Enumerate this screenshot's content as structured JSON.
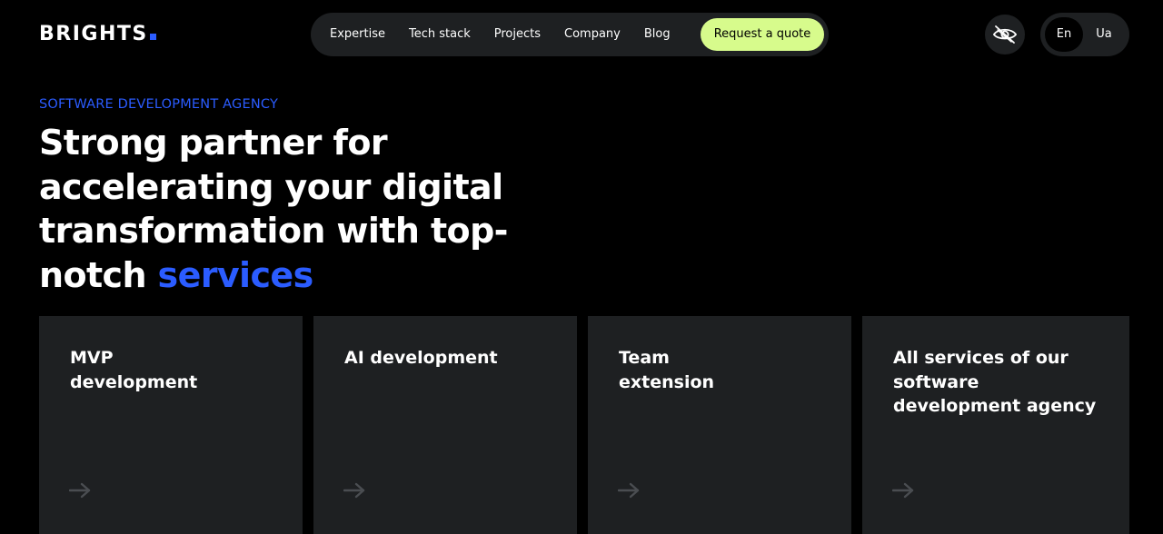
{
  "brand": {
    "logo_text": "BRIGHTS",
    "accent_color": "#2b5cff",
    "cta_color": "#d7fb8c",
    "surface_color": "#1e2022",
    "background_color": "#000000"
  },
  "nav": {
    "links": [
      "Expertise",
      "Tech stack",
      "Projects",
      "Company",
      "Blog"
    ],
    "cta_label": "Request a quote"
  },
  "header_actions": {
    "visibility_icon": "eye-slash-icon",
    "languages": [
      "En",
      "Ua"
    ],
    "active_language": "En"
  },
  "hero": {
    "eyebrow": "SOFTWARE DEVELOPMENT AGENCY",
    "headline_main": "Strong partner for accelerating your digital transformation with top-notch ",
    "headline_accent": "services"
  },
  "services": [
    {
      "title": "MVP development",
      "arrow_icon": "arrow-right-icon"
    },
    {
      "title": "AI development",
      "arrow_icon": "arrow-right-icon"
    },
    {
      "title": "Team extension",
      "arrow_icon": "arrow-right-icon"
    },
    {
      "title": "All services of our software development agency",
      "arrow_icon": "arrow-right-icon"
    }
  ]
}
